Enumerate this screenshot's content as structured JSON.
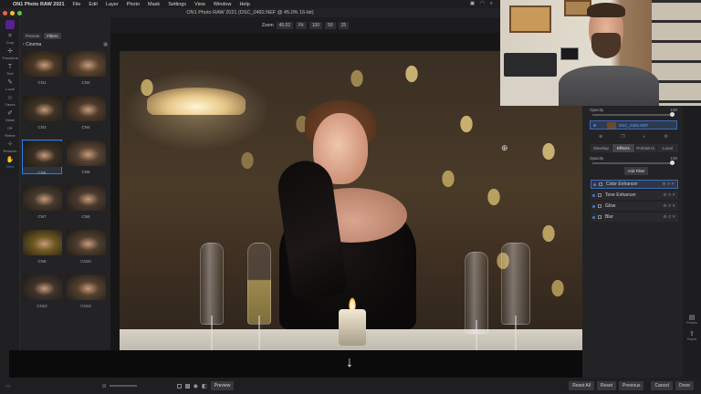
{
  "menubar": {
    "app": "ON1 Photo RAW 2021",
    "items": [
      "File",
      "Edit",
      "Layer",
      "Photo",
      "Mask",
      "Settings",
      "View",
      "Window",
      "Help"
    ]
  },
  "window": {
    "title": "ON1 Photo RAW 2021 (DSC_0482.NEF @ 45.0% 16-bit)"
  },
  "tools": [
    {
      "name": "Crop",
      "icon": "crop-icon",
      "glyph": "⌗"
    },
    {
      "name": "Transform",
      "icon": "transform-icon",
      "glyph": "✛"
    },
    {
      "name": "Text",
      "icon": "text-icon",
      "glyph": "T"
    },
    {
      "name": "Local",
      "icon": "brush-icon",
      "glyph": "✎"
    },
    {
      "name": "Faces",
      "icon": "faces-icon",
      "glyph": "☺"
    },
    {
      "name": "Mask",
      "icon": "mask-icon",
      "glyph": "✐"
    },
    {
      "name": "Refine",
      "icon": "refine-icon",
      "glyph": "✑"
    },
    {
      "name": "Retouch",
      "icon": "retouch-icon",
      "glyph": "✧"
    },
    {
      "name": "View",
      "icon": "hand-icon",
      "glyph": "✋"
    }
  ],
  "browser": {
    "tabs": [
      "Presets",
      "Filters"
    ],
    "active_tab": "Filters",
    "category": "Cinema",
    "thumbs": [
      {
        "label": "CN1",
        "color": "#4a3826"
      },
      {
        "label": "CN2",
        "color": "#5a4430"
      },
      {
        "label": "CN3",
        "color": "#3e3326"
      },
      {
        "label": "CN4",
        "color": "#4d3a2c"
      },
      {
        "label": "CN5",
        "color": "#3a3024",
        "selected": true
      },
      {
        "label": "CN6",
        "color": "#564233"
      },
      {
        "label": "CN7",
        "color": "#45392c"
      },
      {
        "label": "CN8",
        "color": "#4a3a2f"
      },
      {
        "label": "CN9",
        "color": "#6e5a22"
      },
      {
        "label": "CN10",
        "color": "#4e3f2f"
      },
      {
        "label": "CN12",
        "color": "#3f342c"
      },
      {
        "label": "CN13",
        "color": "#52402f"
      }
    ]
  },
  "zoom": {
    "label": "Zoom",
    "value": "45.02",
    "buttons": [
      "Fit",
      "100",
      "50",
      "25"
    ]
  },
  "right_panel": {
    "opacity_label": "Opacity",
    "opacity_value": "100",
    "layer_name": "DSC_0482.NEF",
    "module_tabs": [
      "Develop",
      "Effects",
      "Portrait AI",
      "Local"
    ],
    "active_module": "Effects",
    "effects_opacity_label": "Opacity",
    "effects_opacity_value": "100",
    "add_filter": "Add Filter",
    "filters": [
      "Color Enhancer",
      "Tone Enhancer",
      "Glow",
      "Blur"
    ],
    "selected_filter": "Color Enhancer"
  },
  "right_edge": [
    {
      "label": "Presets",
      "icon": "presets-icon"
    },
    {
      "label": "Export",
      "icon": "export-icon"
    }
  ],
  "bottombar": {
    "preview": "Preview",
    "actions": [
      "Reset All",
      "Reset",
      "Previous",
      "Cancel",
      "Done"
    ]
  }
}
